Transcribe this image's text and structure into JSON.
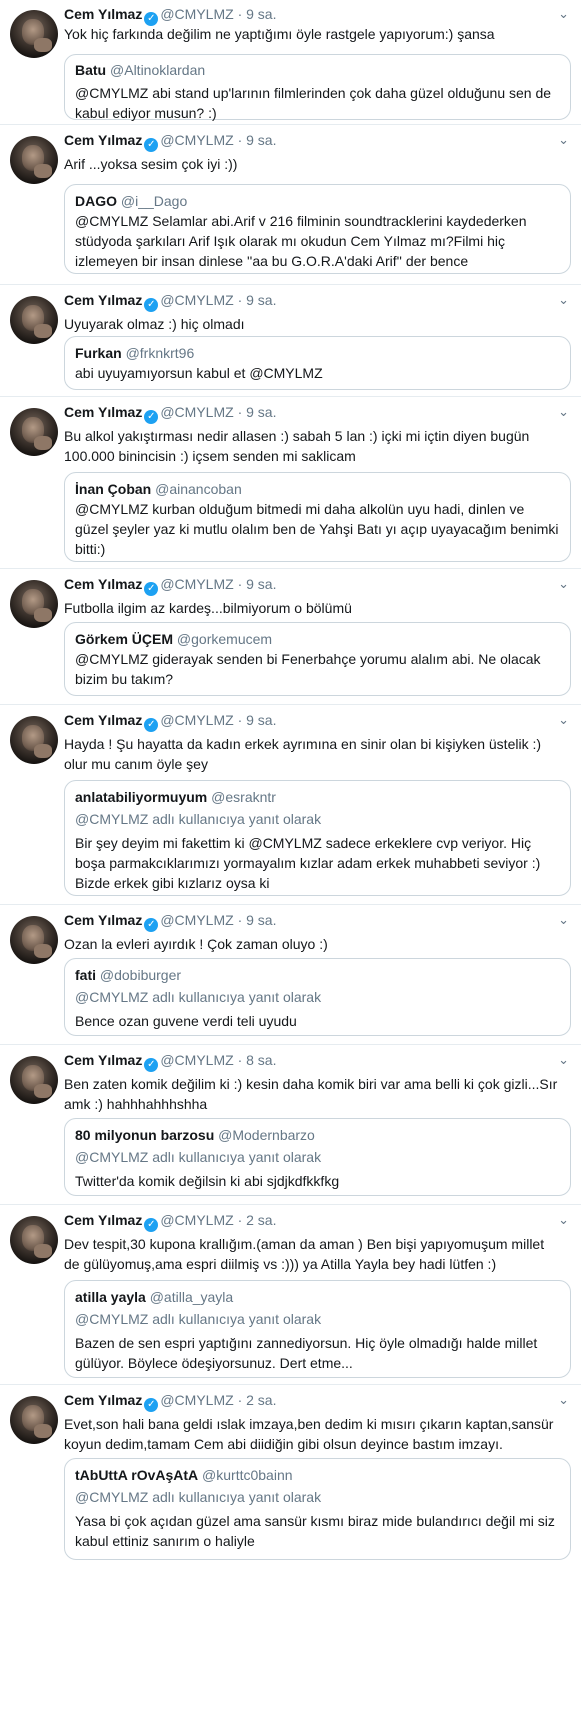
{
  "reply_note": "@CMYLMZ adlı kullanıcıya yanıt olarak",
  "tweets": [
    {
      "name": "Cem Yılmaz",
      "handle": "@CMYLMZ",
      "dot": "·",
      "time": "9 sa.",
      "text": "Yok hiç farkında değilim ne yaptığımı öyle rastgele yapıyorum:) şansa",
      "quote": {
        "name": "Batu",
        "handle": "@Altinoklardan",
        "text": "@CMYLMZ abi stand up'larının filmlerinden çok daha güzel olduğunu sen de kabul ediyor musun? :)"
      }
    },
    {
      "name": "Cem Yılmaz",
      "handle": "@CMYLMZ",
      "dot": "·",
      "time": "9 sa.",
      "text": "Arif ...yoksa sesim çok iyi :))",
      "quote": {
        "name": "DAGO",
        "handle": "@i__Dago",
        "text": "@CMYLMZ Selamlar abi.Arif v 216 filminin soundtracklerini kaydederken stüdyoda şarkıları Arif Işık olarak mı okudun Cem Yılmaz mı?Filmi hiç izlemeyen bir insan dinlese ''aa bu G.O.R.A'daki Arif'' der bence"
      }
    },
    {
      "name": "Cem Yılmaz",
      "handle": "@CMYLMZ",
      "dot": "·",
      "time": "9 sa.",
      "text": "Uyuyarak olmaz :) hiç olmadı",
      "quote": {
        "name": "Furkan",
        "handle": "@frknkrt96",
        "text": "abi uyuyamıyorsun kabul et @CMYLMZ"
      }
    },
    {
      "name": "Cem Yılmaz",
      "handle": "@CMYLMZ",
      "dot": "·",
      "time": "9 sa.",
      "text": "Bu alkol yakıştırması nedir allasen :) sabah 5 lan :) içki mi içtin diyen bugün 100.000 binincisin :) içsem senden mi saklicam",
      "quote": {
        "name": "İnan Çoban",
        "handle": "@ainancoban",
        "text": "@CMYLMZ kurban olduğum bitmedi mi daha alkolün uyu hadi, dinlen ve güzel şeyler yaz ki mutlu olalım ben de Yahşi Batı yı açıp uyayacağım benimki bitti:)"
      }
    },
    {
      "name": "Cem Yılmaz",
      "handle": "@CMYLMZ",
      "dot": "·",
      "time": "9 sa.",
      "text": "Futbolla ilgim az kardeş...bilmiyorum o bölümü",
      "quote": {
        "name": "Görkem ÜÇEM",
        "handle": "@gorkemucem",
        "text": "@CMYLMZ giderayak senden bi Fenerbahçe yorumu alalım abi. Ne olacak bizim bu takım?"
      }
    },
    {
      "name": "Cem Yılmaz",
      "handle": "@CMYLMZ",
      "dot": "·",
      "time": "9 sa.",
      "text": "Hayda ! Şu hayatta da kadın erkek ayrımına en sinir olan bi kişiyken üstelik :) olur mu canım öyle şey",
      "quote": {
        "name": "anlatabiliyormuyum",
        "handle": "@esrakntr",
        "reply": true,
        "text": "Bir şey deyim mi fakettim ki @CMYLMZ sadece erkeklere cvp veriyor. Hiç boşa parmakcıklarımızı yormayalım kızlar adam erkek muhabbeti seviyor :) Bizde erkek gibi kızlarız oysa ki"
      }
    },
    {
      "name": "Cem Yılmaz",
      "handle": "@CMYLMZ",
      "dot": "·",
      "time": "9 sa.",
      "text": "Ozan la evleri ayırdık ! Çok zaman oluyo :)",
      "quote": {
        "name": "fati",
        "handle": "@dobiburger",
        "reply": true,
        "text": "Bence ozan guvene verdi teli uyudu"
      }
    },
    {
      "name": "Cem Yılmaz",
      "handle": "@CMYLMZ",
      "dot": "·",
      "time": "8 sa.",
      "text": "Ben zaten komik değilim ki :) kesin daha komik biri var ama belli ki çok gizli...Sır amk :) hahhhahhhshha",
      "quote": {
        "name": "80 milyonun barzosu",
        "handle": "@Modernbarzo",
        "reply": true,
        "text": "Twitter'da komik değilsin ki abi sjdjkdfkkfkg"
      }
    },
    {
      "name": "Cem Yılmaz",
      "handle": "@CMYLMZ",
      "dot": "·",
      "time": "2 sa.",
      "text": "Dev tespit,30 kupona krallığım.(aman da aman ) Ben bişi yapıyomuşum millet de gülüyomuş,ama espri diilmiş vs :))) ya Atilla Yayla bey hadi lütfen :)",
      "quote": {
        "name": "atilla yayla",
        "handle": "@atilla_yayla",
        "reply": true,
        "text": "Bazen de sen espri yaptığını zannediyorsun. Hiç öyle olmadığı halde millet gülüyor. Böylece ödeşiyorsunuz. Dert etme..."
      }
    },
    {
      "name": "Cem Yılmaz",
      "handle": "@CMYLMZ",
      "dot": "·",
      "time": "2 sa.",
      "text": "Evet,son hali bana geldi ıslak imzaya,ben dedim ki mısırı çıkarın kaptan,sansür koyun dedim,tamam Cem abi diidiğin gibi olsun deyince bastım imzayı.",
      "quote": {
        "name": "tAbUttA rOvAşAtA",
        "handle": "@kurttc0bainn",
        "reply": true,
        "text": "Yasa bi çok açıdan güzel ama sansür kısmı biraz mide bulandırıcı değil mi siz kabul ettiniz sanırım o haliyle"
      }
    }
  ]
}
